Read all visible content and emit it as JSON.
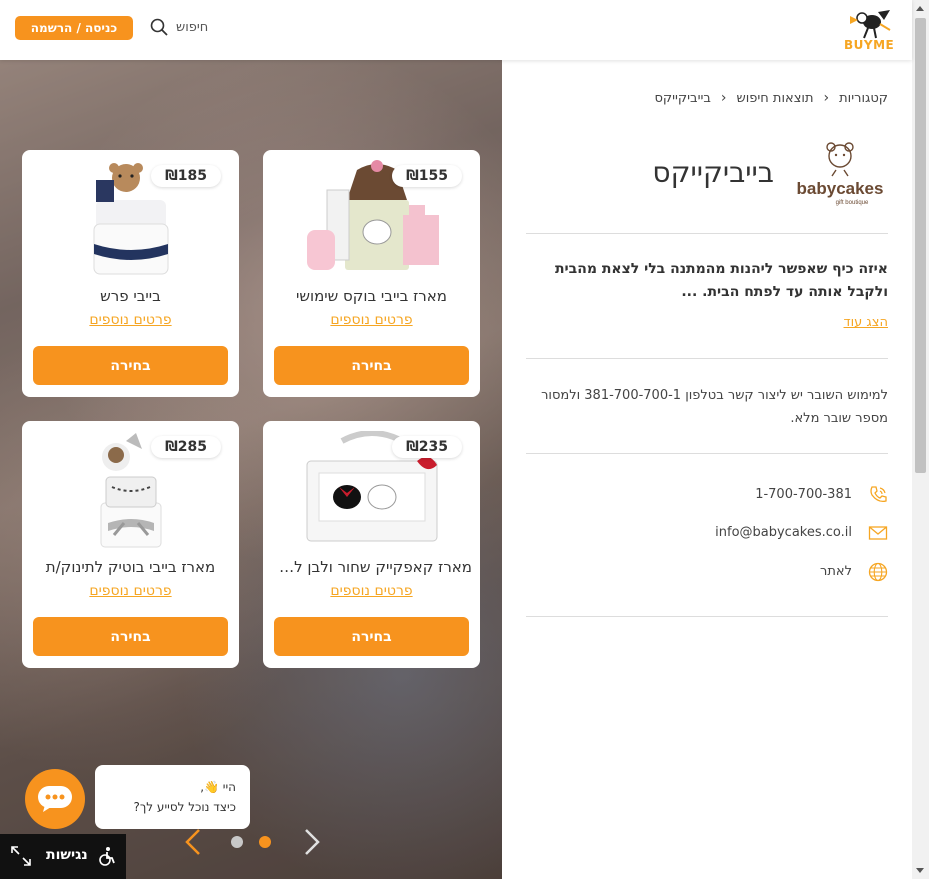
{
  "header": {
    "logo_text": "BUYME",
    "search_label": "חיפוש",
    "login_label": "כניסה / הרשמה"
  },
  "products": [
    {
      "title": "מארז בייבי בוקס שימושי",
      "price": "₪155",
      "more_label": "פרטים נוספים",
      "button_label": "בחירה",
      "image": "pink-baby-box-icon"
    },
    {
      "title": "בייבי פרש",
      "price": "₪185",
      "more_label": "פרטים נוספים",
      "button_label": "בחירה",
      "image": "diaper-cake-teddy-icon"
    },
    {
      "title": "מארז קאפקייק שחור ולבן לתי...",
      "price": "₪235",
      "more_label": "פרטים נוספים",
      "button_label": "בחירה",
      "image": "cupcake-box-icon"
    },
    {
      "title": "מארז בייבי בוטיק לתינוק/ת",
      "price": "₪285",
      "more_label": "פרטים נוספים",
      "button_label": "בחירה",
      "image": "boutique-cake-icon"
    }
  ],
  "chat": {
    "greeting": "היי 👋,",
    "question": "כיצד נוכל לסייע לך?"
  },
  "accessibility": {
    "label": "נגישות"
  },
  "breadcrumb": [
    "קטגוריות",
    "תוצאות חיפוש",
    "בייביקייקס"
  ],
  "brand": {
    "name": "בייביקייקס",
    "logo_text": "babycakes",
    "logo_subtext": "gift boutique"
  },
  "description": "איזה כיף שאפשר ליהנות מהמתנה בלי לצאת מהבית ולקבל אותה עד לפתח הבית. ...",
  "show_more": "הצג עוד",
  "redeem_info": "למימוש השובר יש ליצור קשר בטלפון 381-700-700-1 ולמסור מספר שובר מלא.",
  "contact": {
    "phone": "1-700-700-381",
    "email": "info@babycakes.co.il",
    "website": "לאתר"
  },
  "colors": {
    "accent": "#f7931e",
    "link": "#f6a623"
  }
}
